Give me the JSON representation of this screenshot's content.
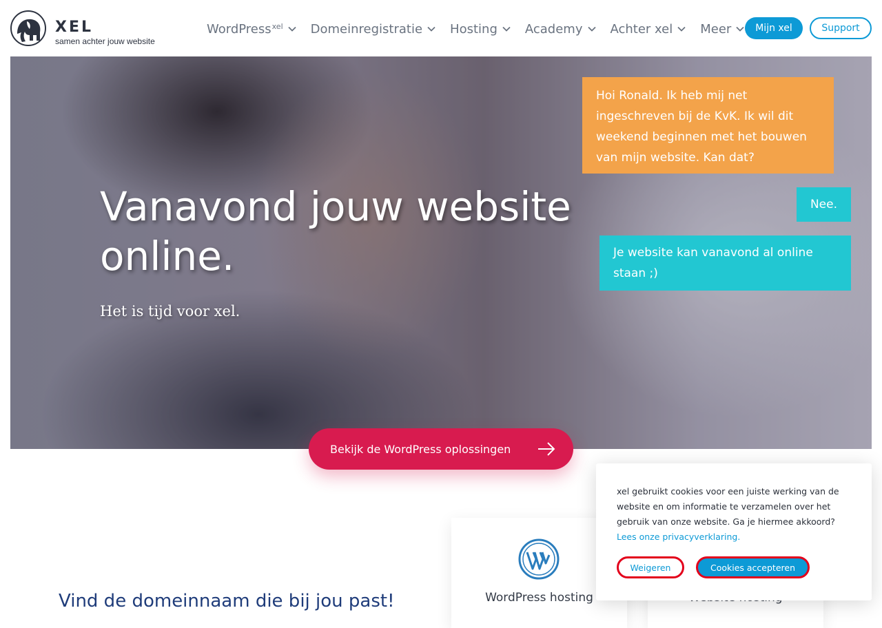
{
  "brand": {
    "name": "XEL",
    "tagline": "samen achter jouw website"
  },
  "nav": {
    "items": [
      {
        "label": "WordPress",
        "sup": "xel"
      },
      {
        "label": "Domeinregistratie"
      },
      {
        "label": "Hosting"
      },
      {
        "label": "Academy"
      },
      {
        "label": "Achter xel"
      },
      {
        "label": "Meer"
      }
    ],
    "mijn_xel": "Mijn xel",
    "support": "Support"
  },
  "hero": {
    "title": "Vanavond jouw website online.",
    "subtitle": "Het is tijd voor xel.",
    "chat": [
      {
        "text": "Hoi Ronald. Ik heb mij net ingeschreven bij de KvK. Ik wil dit weekend beginnen met het bouwen van mijn website. Kan dat?",
        "color": "#f3a34a"
      },
      {
        "text": "Nee.",
        "color": "#22c7d2"
      },
      {
        "text": "Je website kan vanavond al online staan ;)",
        "color": "#22c7d2"
      }
    ]
  },
  "cta": {
    "label": "Bekijk de WordPress oplossingen",
    "color": "#d81b4f"
  },
  "domain_section": {
    "heading": "Vind de domeinnaam die bij jou past!"
  },
  "cards": [
    {
      "label": "WordPress hosting",
      "icon": "wordpress-icon"
    },
    {
      "label": "Website hosting"
    }
  ],
  "cookie_banner": {
    "text": "xel gebruikt cookies voor een juiste werking van de website en om informatie te verzamelen over het gebruik van onze website. Ga je hiermee akkoord?",
    "privacy_link": "Lees onze privacyverklaring.",
    "refuse": "Weigeren",
    "accept": "Cookies accepteren"
  },
  "colors": {
    "brand_blue": "#0d9ad6",
    "navy": "#1f3c7a",
    "orange": "#f3a34a",
    "teal": "#22c7d2",
    "red": "#d81b4f"
  }
}
